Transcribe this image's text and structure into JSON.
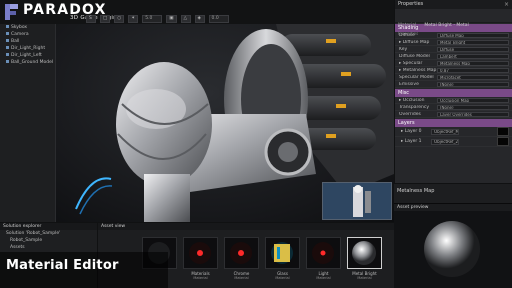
{
  "app": {
    "logo_text": "PARADOX",
    "logo_sub": "3D Game Engine"
  },
  "toolbar": {
    "buttons": [
      "S",
      "□",
      "○",
      "✶",
      "5.0",
      "▣",
      "△",
      "◈"
    ],
    "field": "0.0"
  },
  "scene": {
    "items": [
      {
        "label": "Skybox",
        "level": 1
      },
      {
        "label": "Camera",
        "level": 1
      },
      {
        "label": "Ball",
        "level": 1
      },
      {
        "label": "Dir_Light_Right",
        "level": 1
      },
      {
        "label": "Dir_Light_Left",
        "level": 1
      },
      {
        "label": "Ball_Ground Model",
        "level": 1
      }
    ]
  },
  "properties": {
    "title": "Properties",
    "header_label": "Material",
    "header_value": "Metal Bright - Metal",
    "header_hint": "Properties",
    "sections": {
      "shading": "Shading",
      "misc": "Misc",
      "layers": "Layers"
    },
    "rows_shading": [
      {
        "k": "Diffuse",
        "v": "Diffuse Map"
      },
      {
        "k": "▸ Diffuse Map",
        "v": "Metal_Bright"
      },
      {
        "k": "Key",
        "v": "Diffuse"
      },
      {
        "k": "Diffuse Model",
        "v": "Lambert"
      },
      {
        "k": "▸ Specular",
        "v": "Metalness Map"
      },
      {
        "k": "▸ Metalness Map",
        "v": "0.87"
      },
      {
        "k": "Specular Model",
        "v": "Microfacet"
      },
      {
        "k": "Emissive",
        "v": "(None)"
      }
    ],
    "rows_misc": [
      {
        "k": "▸ Occlusion",
        "v": "Occlusion Map"
      },
      {
        "k": "Transparency",
        "v": "(None)"
      },
      {
        "k": "Overrides",
        "v": "Layer Overrides"
      }
    ],
    "layers": [
      {
        "k": "▸ Layer 0",
        "v": "ObjectRef_Mat"
      },
      {
        "k": "▸ Layer 1",
        "v": "ObjectRef_2"
      }
    ]
  },
  "material_map": "Metalness Map",
  "solution": {
    "title": "Solution explorer",
    "items": [
      {
        "label": "Solution 'Robot_Sample'",
        "level": 1
      },
      {
        "label": "Robot_Sample",
        "level": 2
      },
      {
        "label": "Assets",
        "level": 2
      }
    ]
  },
  "assets": {
    "title": "Asset view",
    "tiles": [
      {
        "name": "",
        "sub": "",
        "glow": "none"
      },
      {
        "name": "Materials",
        "sub": "Material",
        "glow": "#ff2a2a"
      },
      {
        "name": "Chrome",
        "sub": "Material",
        "glow": "#ff2a2a"
      },
      {
        "name": "Glass",
        "sub": "Material",
        "glow": "#ffd84a"
      },
      {
        "name": "Light",
        "sub": "Material",
        "glow": "#ff2a2a"
      },
      {
        "name": "Metal Bright",
        "sub": "Material",
        "glow": "sphere"
      }
    ]
  },
  "preview": {
    "title": "Asset preview"
  },
  "caption": "Material Editor",
  "colors": {
    "accent": "#7a4a88",
    "logo_mark": "#7a7ec9"
  }
}
